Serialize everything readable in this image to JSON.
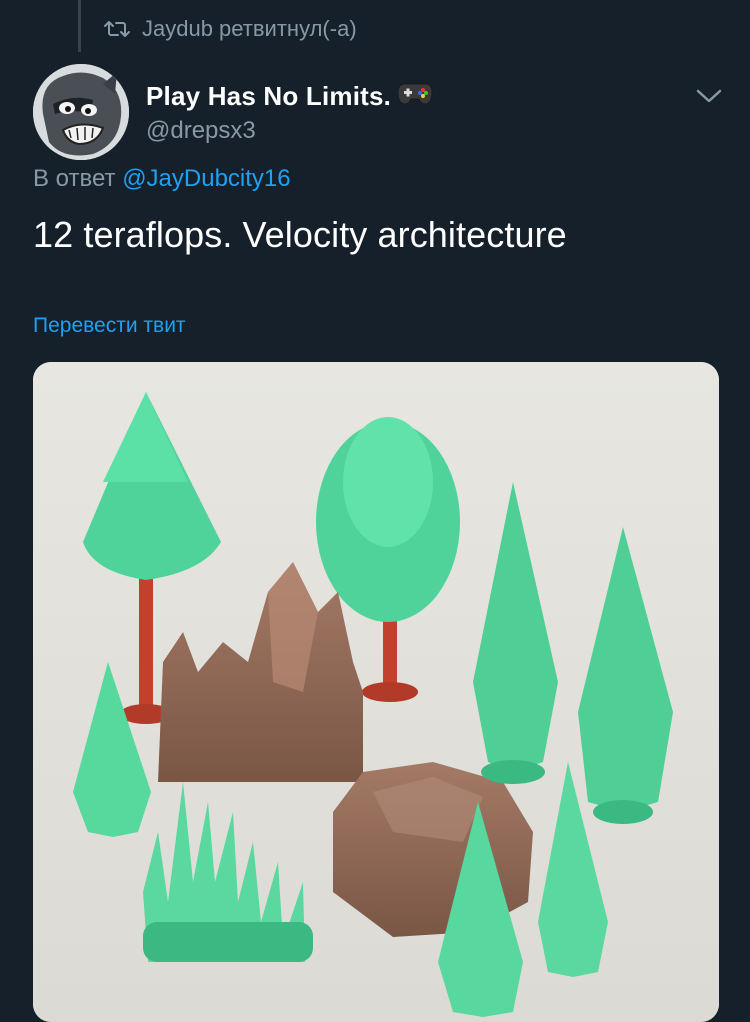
{
  "retweet": {
    "icon": "retweet-icon",
    "text": "Jaydub ретвитнул(-а)"
  },
  "author": {
    "avatar": "avatar-cartoon-raccoon",
    "display_name": "Play Has No Limits.",
    "name_emoji": "gamepad-icon",
    "handle": "@drepsx3"
  },
  "reply": {
    "prefix": "В ответ",
    "mention": "@JayDubcity16"
  },
  "tweet": {
    "text": "12 teraflops. Velocity architecture",
    "translate_label": "Перевести твит"
  },
  "media": {
    "icon": "photo-toy-trees-and-rocks"
  },
  "menu": {
    "icon": "chevron-down-icon"
  },
  "colors": {
    "background": "#15202b",
    "secondary_text": "#8899a6",
    "link": "#1da1f2",
    "primary_text": "#ffffff"
  }
}
